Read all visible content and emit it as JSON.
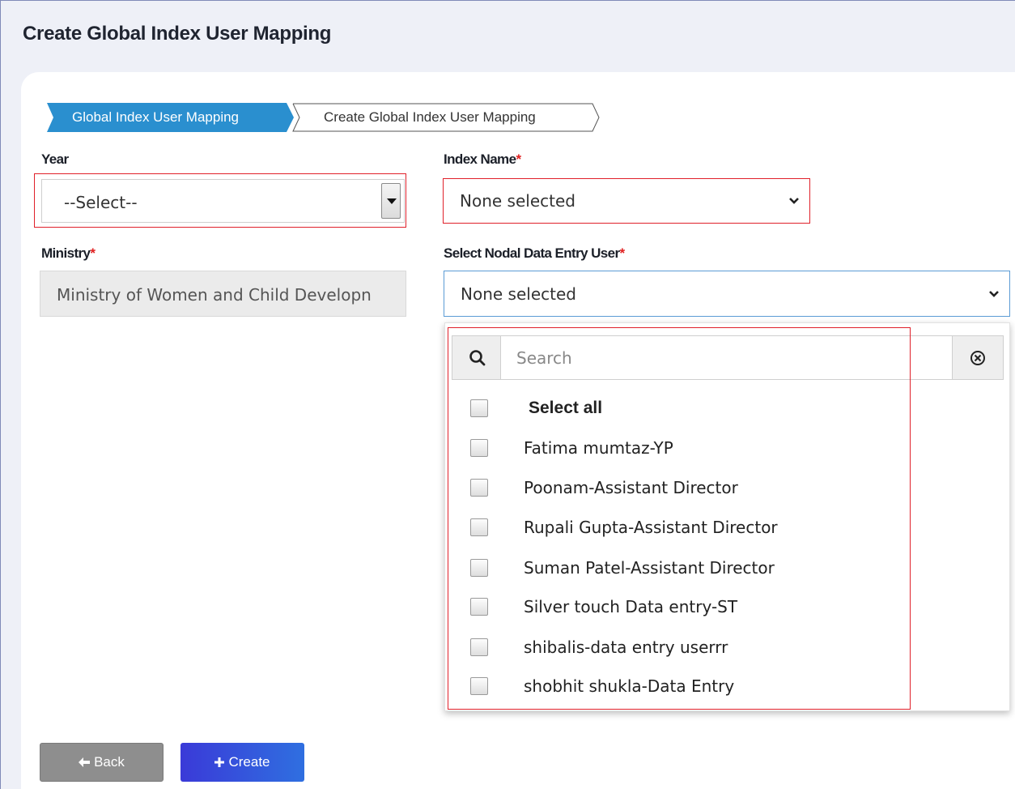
{
  "page": {
    "title": "Create Global Index User Mapping"
  },
  "breadcrumb": {
    "active": "Global Index User Mapping",
    "next": "Create Global Index User Mapping"
  },
  "year": {
    "label": "Year",
    "value": "--Select--"
  },
  "index_name": {
    "label": "Index Name",
    "required_mark": "*",
    "value": "None selected"
  },
  "ministry": {
    "label": "Ministry",
    "required_mark": "*",
    "value": "Ministry of Women and Child Developn"
  },
  "nodal_user": {
    "label": "Select Nodal Data Entry User",
    "required_mark": "*",
    "value": "None selected",
    "search_placeholder": "Search",
    "select_all": "Select all",
    "options": [
      "Fatima mumtaz-YP",
      "Poonam-Assistant Director",
      "Rupali Gupta-Assistant Director",
      "Suman Patel-Assistant Director",
      "Silver touch Data entry-ST",
      "shibalis-data entry userrr",
      "shobhit shukla-Data Entry"
    ]
  },
  "buttons": {
    "back": "Back",
    "create": "Create"
  },
  "colors": {
    "accent": "#2a8fcf",
    "highlight": "#e0202a",
    "create_button": "#3a3ad8",
    "back_button": "#8e8e8e"
  }
}
